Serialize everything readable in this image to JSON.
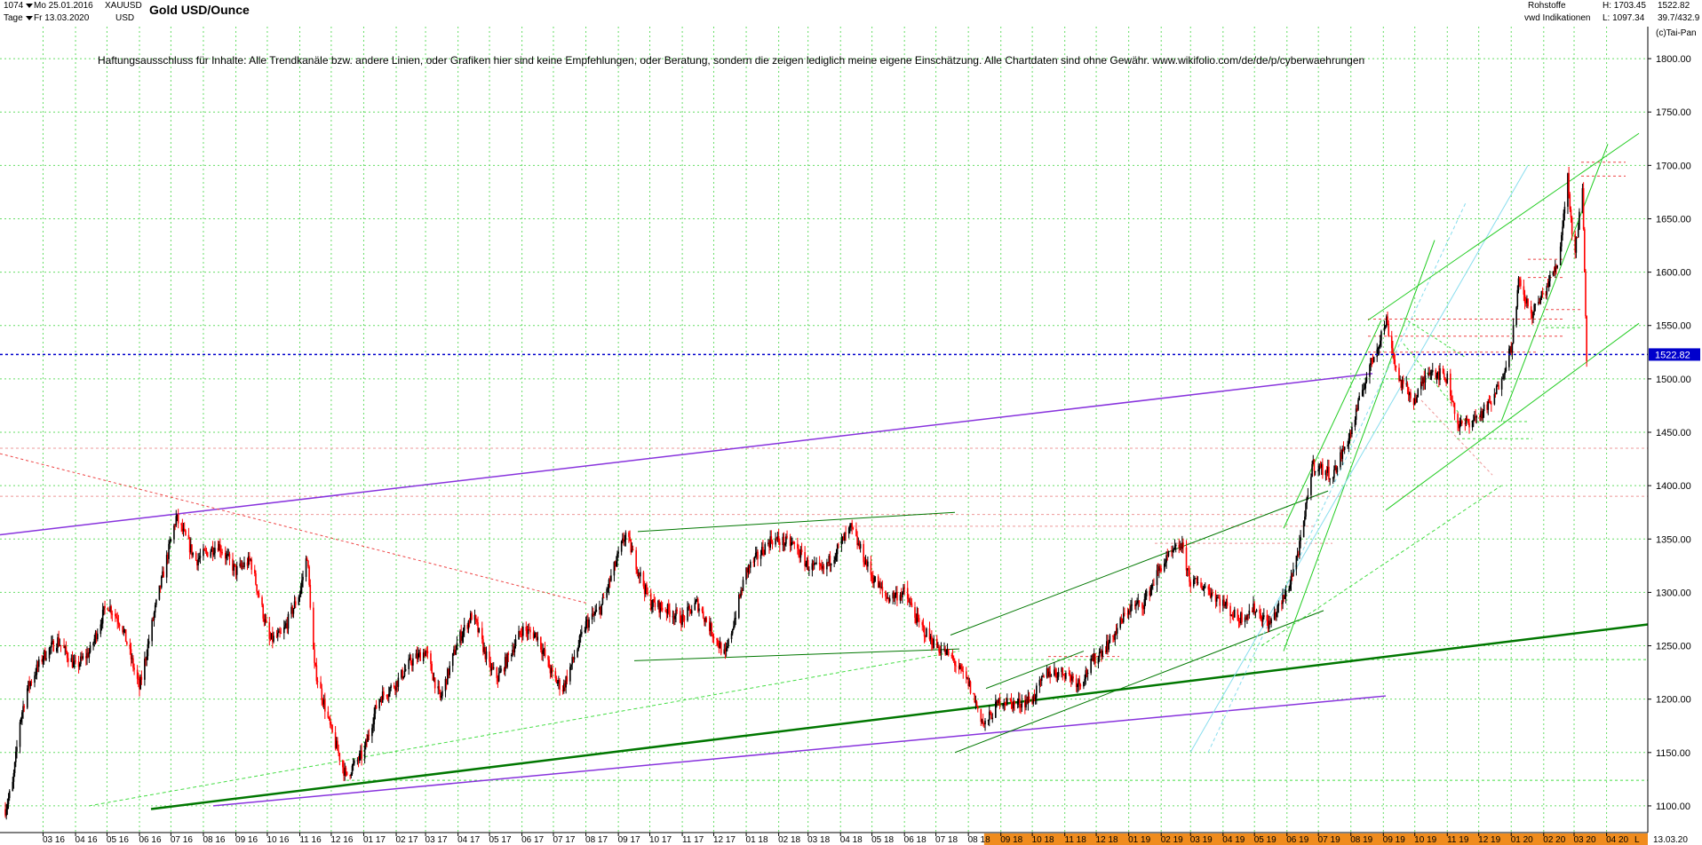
{
  "header": {
    "count": "1074",
    "from_date": "Mo 25.01.2016",
    "period": "Tage",
    "to_date": "Fr 13.03.2020",
    "symbol": "XAUUSD",
    "currency": "USD",
    "title": "Gold USD/Ounce",
    "category": "Rohstoffe",
    "source": "vwd Indikationen",
    "high_label": "H: 1703.45",
    "low_label": "L: 1097.34",
    "last": "1522.82",
    "stat": "39.7/432.9",
    "copyright": "(c)Tai-Pan"
  },
  "disclaimer": "Haftungsausschluss für Inhalte: Alle Trendkanäle bzw. andere Linien, oder Grafiken hier sind keine Empfehlungen, oder Beratung, sondern die zeigen lediglich meine eigene Einschätzung. Alle Chartdaten sind ohne Gewähr.  www.wikifolio.com/de/de/p/cyberwaehrungen",
  "colors": {
    "up_candle": "#000000",
    "down_candle": "#ff0000",
    "grid": "#66dd66",
    "price_line": "#0000cc",
    "price_label_bg": "#0000cc",
    "x_axis_band": "#f08c1e",
    "purple": "#8833dd",
    "dark_green": "#007700",
    "green": "#22cc22",
    "light_green": "#44dd44",
    "cyan": "#88ddee",
    "pink": "#ee9999",
    "red_dotted": "#ee4444"
  },
  "chart_data": {
    "type": "line",
    "title": "Gold USD/Ounce",
    "ylim": [
      1075,
      1830
    ],
    "y_ticks": [
      1100,
      1150,
      1200,
      1250,
      1300,
      1350,
      1400,
      1450,
      1500,
      1550,
      1600,
      1650,
      1700,
      1750,
      1800
    ],
    "y_tick_labels": [
      "1100.00",
      "1150.00",
      "1200.00",
      "1250.00",
      "1300.00",
      "1350.00",
      "1400.00",
      "1450.00",
      "1500.00",
      "1550.00",
      "1600.00",
      "1650.00",
      "1700.00",
      "1750.00",
      "1800.00"
    ],
    "x_tick_labels": [
      "03 16",
      "04 16",
      "05 16",
      "06 16",
      "07 16",
      "08 16",
      "09 16",
      "10 16",
      "11 16",
      "12 16",
      "01 17",
      "02 17",
      "03 17",
      "04 17",
      "05 17",
      "06 17",
      "07 17",
      "08 17",
      "09 17",
      "10 17",
      "11 17",
      "12 17",
      "01 18",
      "02 18",
      "03 18",
      "04 18",
      "05 18",
      "06 18",
      "07 18",
      "08 18",
      "09 18",
      "10 18",
      "11 18",
      "12 18",
      "01 19",
      "02 19",
      "03 19",
      "04 19",
      "05 19",
      "06 19",
      "07 19",
      "08 19",
      "09 19",
      "10 19",
      "11 19",
      "12 19",
      "01 20",
      "02 20",
      "03 20",
      "04 20"
    ],
    "x_end_label": "13.03.20",
    "x_axis_suffix": "L",
    "last_price": 1522.82,
    "last_price_label": "1522.82",
    "series": [
      {
        "x": [
          "2016-01-25",
          "2016-02-01",
          "2016-02-08",
          "2016-02-15",
          "2016-03-01",
          "2016-03-15",
          "2016-04-01",
          "2016-04-15",
          "2016-05-01",
          "2016-05-15",
          "2016-06-01",
          "2016-06-15",
          "2016-07-06",
          "2016-07-25",
          "2016-08-15",
          "2016-09-01",
          "2016-09-15",
          "2016-10-03",
          "2016-10-15",
          "2016-11-01",
          "2016-11-08",
          "2016-11-15",
          "2016-12-01",
          "2016-12-15",
          "2017-01-01",
          "2017-01-15",
          "2017-02-01",
          "2017-02-15",
          "2017-03-01",
          "2017-03-15",
          "2017-04-01",
          "2017-04-15",
          "2017-05-01",
          "2017-05-09",
          "2017-06-01",
          "2017-06-15",
          "2017-07-01",
          "2017-07-10",
          "2017-08-01",
          "2017-08-15",
          "2017-09-08",
          "2017-10-01",
          "2017-10-15",
          "2017-11-01",
          "2017-11-15",
          "2017-12-12",
          "2018-01-01",
          "2018-01-25",
          "2018-02-15",
          "2018-03-01",
          "2018-03-15",
          "2018-04-11",
          "2018-05-01",
          "2018-05-15",
          "2018-06-01",
          "2018-06-15",
          "2018-07-01",
          "2018-07-15",
          "2018-08-01",
          "2018-08-16",
          "2018-09-01",
          "2018-09-15",
          "2018-10-01",
          "2018-10-15",
          "2018-11-01",
          "2018-11-15",
          "2018-12-01",
          "2018-12-15",
          "2019-01-01",
          "2019-01-15",
          "2019-02-01",
          "2019-02-20",
          "2019-03-01",
          "2019-03-15",
          "2019-04-01",
          "2019-04-15",
          "2019-05-01",
          "2019-05-15",
          "2019-06-01",
          "2019-06-15",
          "2019-06-25",
          "2019-07-15",
          "2019-08-01",
          "2019-08-15",
          "2019-09-04",
          "2019-09-15",
          "2019-10-01",
          "2019-10-15",
          "2019-11-01",
          "2019-11-12",
          "2019-12-01",
          "2019-12-15",
          "2020-01-01",
          "2020-01-08",
          "2020-01-20",
          "2020-02-01",
          "2020-02-15",
          "2020-02-24",
          "2020-03-01",
          "2020-03-09",
          "2020-03-13"
        ],
        "y": [
          1097,
          1120,
          1180,
          1210,
          1240,
          1255,
          1230,
          1245,
          1290,
          1270,
          1210,
          1280,
          1370,
          1330,
          1345,
          1320,
          1330,
          1255,
          1260,
          1300,
          1335,
          1230,
          1170,
          1128,
          1150,
          1200,
          1215,
          1235,
          1245,
          1200,
          1255,
          1280,
          1230,
          1220,
          1265,
          1260,
          1220,
          1210,
          1270,
          1285,
          1355,
          1290,
          1285,
          1275,
          1290,
          1240,
          1320,
          1350,
          1345,
          1325,
          1320,
          1360,
          1315,
          1295,
          1300,
          1270,
          1250,
          1240,
          1215,
          1175,
          1200,
          1195,
          1200,
          1225,
          1225,
          1215,
          1240,
          1255,
          1285,
          1290,
          1325,
          1345,
          1310,
          1305,
          1290,
          1275,
          1285,
          1270,
          1300,
          1350,
          1420,
          1410,
          1450,
          1500,
          1555,
          1500,
          1480,
          1510,
          1500,
          1455,
          1465,
          1480,
          1530,
          1590,
          1560,
          1580,
          1610,
          1690,
          1610,
          1680,
          1522
        ]
      }
    ]
  }
}
